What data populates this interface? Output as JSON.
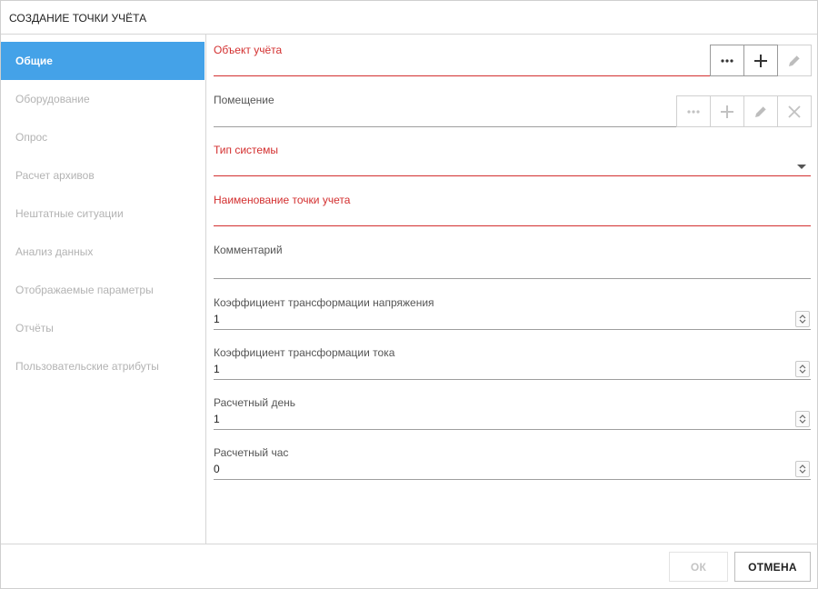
{
  "dialog": {
    "title": "СОЗДАНИЕ ТОЧКИ УЧЁТА"
  },
  "sidebar": {
    "items": [
      {
        "label": "Общие",
        "active": true
      },
      {
        "label": "Оборудование"
      },
      {
        "label": "Опрос"
      },
      {
        "label": "Расчет архивов"
      },
      {
        "label": "Нештатные ситуации"
      },
      {
        "label": "Анализ данных"
      },
      {
        "label": "Отображаемые параметры"
      },
      {
        "label": "Отчёты"
      },
      {
        "label": "Пользовательские атрибуты"
      }
    ]
  },
  "form": {
    "accounting_object": {
      "label": "Объект учёта",
      "value": "",
      "required": true
    },
    "premises": {
      "label": "Помещение",
      "value": ""
    },
    "system_type": {
      "label": "Тип системы",
      "value": "",
      "required": true
    },
    "point_name": {
      "label": "Наименование точки учета",
      "value": "",
      "required": true
    },
    "comment": {
      "label": "Комментарий",
      "value": ""
    },
    "voltage_ratio": {
      "label": "Коэффициент трансформации напряжения",
      "value": "1"
    },
    "current_ratio": {
      "label": "Коэффициент трансформации тока",
      "value": "1"
    },
    "billing_day": {
      "label": "Расчетный день",
      "value": "1"
    },
    "billing_hour": {
      "label": "Расчетный час",
      "value": "0"
    }
  },
  "footer": {
    "ok_label": "ОК",
    "cancel_label": "ОТМЕНА"
  },
  "colors": {
    "accent": "#44a2e8",
    "required": "#d32f2f",
    "inactive_text": "#b3b3b3"
  }
}
